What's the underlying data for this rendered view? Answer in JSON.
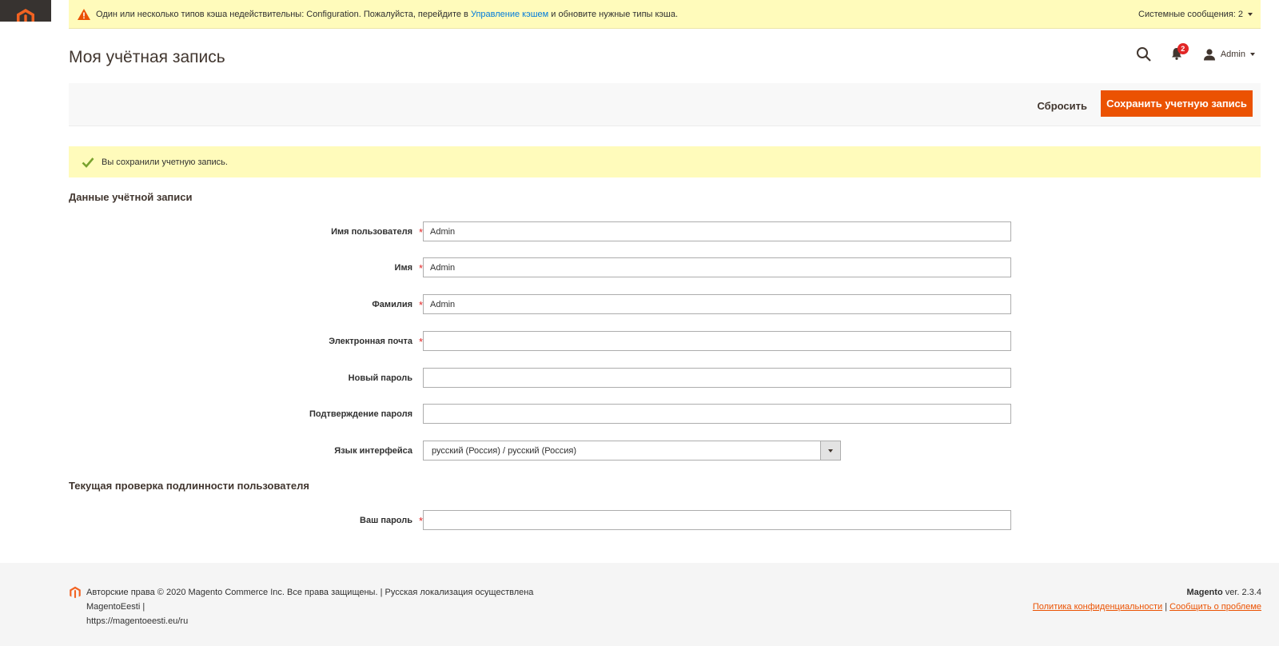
{
  "system_message": {
    "text_before": "Один или несколько типов кэша недействительны: Configuration. Пожалуйста, перейдите в",
    "link": "Управление кэшем",
    "text_after": "и обновите нужные типы кэша.",
    "counter": "Системные сообщения: 2"
  },
  "header": {
    "title": "Моя учётная запись",
    "notifications_count": "2",
    "user_name": "Admin"
  },
  "actions": {
    "reset_label": "Сбросить",
    "save_label": "Сохранить учетную запись"
  },
  "success_message": "Вы сохранили учетную запись.",
  "account_section": {
    "title": "Данные учётной записи",
    "fields": {
      "username": {
        "label": "Имя пользователя",
        "value": "Admin"
      },
      "firstname": {
        "label": "Имя",
        "value": "Admin"
      },
      "lastname": {
        "label": "Фамилия",
        "value": "Admin"
      },
      "email": {
        "label": "Электронная почта",
        "value": ""
      },
      "new_password": {
        "label": "Новый пароль",
        "value": ""
      },
      "confirm_password": {
        "label": "Подтверждение пароля",
        "value": ""
      },
      "interface_locale": {
        "label": "Язык интерфейса",
        "value": "русский (Россия) / русский (Россия)"
      }
    }
  },
  "verification_section": {
    "title": "Текущая проверка подлинности пользователя",
    "fields": {
      "current_password": {
        "label": "Ваш пароль",
        "value": ""
      }
    }
  },
  "required_mark": "*",
  "footer": {
    "copyright": "Авторские права © 2020 Magento Commerce Inc. Все права защищены. | Русская локализация осуществлена MagentoEesti |",
    "copyright_url": "https://magentoeesti.eu/ru",
    "brand": "Magento",
    "version": "ver. 2.3.4",
    "privacy_link": "Политика конфиденциальности",
    "separator": "|",
    "report_link": "Сообщить о проблеме"
  },
  "colors": {
    "accent": "#eb5202",
    "message_bg": "#fffbbb",
    "link": "#007bdb",
    "sidebar_dark": "#373330",
    "success_check": "#79a22e",
    "warning": "#eb5202",
    "badge": "#e22626"
  }
}
